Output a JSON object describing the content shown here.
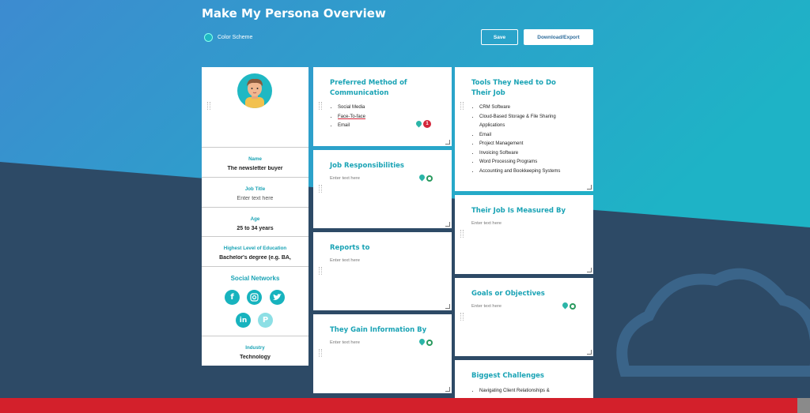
{
  "header": {
    "title": "Make My Persona Overview",
    "color_scheme_label": "Color Scheme",
    "save_label": "Save",
    "download_label": "Download/Export"
  },
  "profile": {
    "avatar_icon": "persona-avatar-icon",
    "fields": [
      {
        "label": "Name",
        "value": "The newsletter buyer"
      },
      {
        "label": "Job Title",
        "value": "Enter text here"
      },
      {
        "label": "Age",
        "value": "25 to 34 years"
      },
      {
        "label": "Highest Level of Education",
        "value": "Bachelor's degree (e.g. BA,"
      }
    ],
    "social_title": "Social Networks",
    "social_icons": [
      "facebook-icon",
      "instagram-icon",
      "twitter-icon",
      "linkedin-icon",
      "pinterest-icon"
    ],
    "industry_label": "Industry",
    "industry_value": "Technology"
  },
  "cards": {
    "communication": {
      "title": "Preferred Method of Communication",
      "items": [
        "Social Media",
        "Face-To-face",
        "Email"
      ],
      "badge": "1"
    },
    "responsibilities": {
      "title": "Job Responsibilities",
      "placeholder": "Enter text here"
    },
    "reports_to": {
      "title": "Reports to",
      "placeholder": "Enter text here"
    },
    "gain_info": {
      "title": "They Gain Information By",
      "placeholder": "Enter text here"
    },
    "tools": {
      "title": "Tools They Need to Do Their Job",
      "items": [
        "CRM Software",
        "Cloud-Based Storage & File Sharing Applications",
        "Email",
        "Project Management",
        "Invoicing Software",
        "Word Processing Programs",
        "Accounting and Bookkeeping Systems"
      ]
    },
    "measured_by": {
      "title": "Their Job Is Measured By",
      "placeholder": "Enter text here"
    },
    "goals": {
      "title": "Goals or Objectives",
      "placeholder": "Enter text here"
    },
    "challenges": {
      "title": "Biggest Challenges",
      "items": [
        "Navigating Client Relationships &"
      ]
    }
  },
  "colors": {
    "accent": "#1aa3b5",
    "sky_top": "#3d8fcf",
    "sky_bottom": "#21b0c9",
    "navy": "#2d4a66",
    "footer": "#d3202b"
  }
}
